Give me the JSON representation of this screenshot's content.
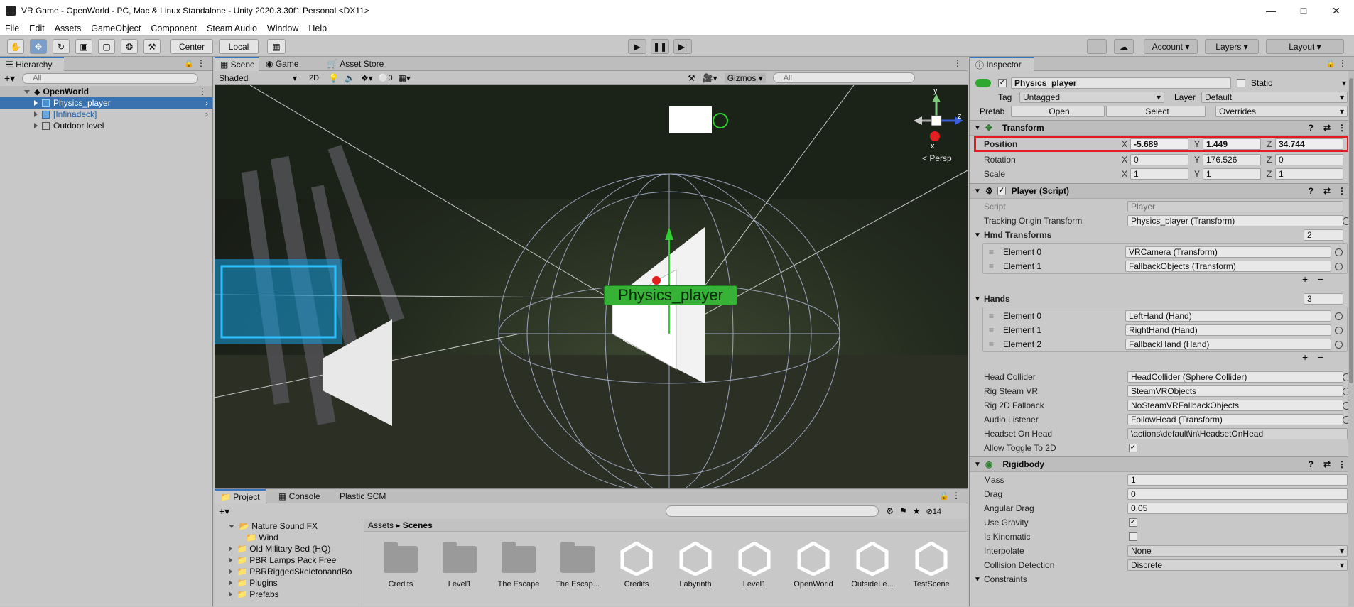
{
  "window": {
    "title": "VR Game - OpenWorld - PC, Mac & Linux Standalone - Unity 2020.3.30f1 Personal <DX11>"
  },
  "menu": [
    "File",
    "Edit",
    "Assets",
    "GameObject",
    "Component",
    "Steam Audio",
    "Window",
    "Help"
  ],
  "toolbar": {
    "center_label": "Center",
    "local_label": "Local",
    "account_label": "Account",
    "layers_label": "Layers",
    "layout_label": "Layout"
  },
  "hierarchy": {
    "tab": "Hierarchy",
    "search_placeholder": "All",
    "scene": "OpenWorld",
    "items": [
      {
        "label": "Physics_player"
      },
      {
        "label": "[Infinadeck]"
      },
      {
        "label": "Outdoor level"
      }
    ]
  },
  "scene_view": {
    "tabs": [
      "Scene",
      "Game",
      "Asset Store"
    ],
    "shading": "Shaded",
    "mode_2d": "2D",
    "hidden_count": "0",
    "gizmos": "Gizmos",
    "search_placeholder": "All",
    "persp_label": "< Persp",
    "object_label": "Physics_player",
    "axis_x": "x",
    "axis_y": "y",
    "axis_z": "z"
  },
  "project": {
    "tabs": [
      "Project",
      "Console",
      "Plastic SCM"
    ],
    "badge": "14",
    "tree": [
      "Nature Sound FX",
      "Wind",
      "Old Military Bed (HQ)",
      "PBR Lamps Pack Free",
      "PBRRiggedSkeletonandBo",
      "Plugins",
      "Prefabs"
    ],
    "breadcrumb": [
      "Assets",
      "Scenes"
    ],
    "assets": [
      {
        "name": "Credits",
        "kind": "folder"
      },
      {
        "name": "Level1",
        "kind": "folder"
      },
      {
        "name": "The Escape",
        "kind": "folder"
      },
      {
        "name": "The Escap...",
        "kind": "folder"
      },
      {
        "name": "Credits",
        "kind": "scene"
      },
      {
        "name": "Labyrinth",
        "kind": "scene"
      },
      {
        "name": "Level1",
        "kind": "scene"
      },
      {
        "name": "OpenWorld",
        "kind": "scene"
      },
      {
        "name": "OutsideLe...",
        "kind": "scene"
      },
      {
        "name": "TestScene",
        "kind": "scene"
      }
    ]
  },
  "inspector": {
    "tab": "Inspector",
    "object_name": "Physics_player",
    "static_label": "Static",
    "tag_label": "Tag",
    "tag_value": "Untagged",
    "layer_label": "Layer",
    "layer_value": "Default",
    "prefab_label": "Prefab",
    "open_label": "Open",
    "select_label": "Select",
    "overrides_label": "Overrides",
    "transform": {
      "title": "Transform",
      "position": {
        "label": "Position",
        "x": "-5.689",
        "y": "1.449",
        "z": "34.744"
      },
      "rotation": {
        "label": "Rotation",
        "x": "0",
        "y": "176.526",
        "z": "0"
      },
      "scale": {
        "label": "Scale",
        "x": "1",
        "y": "1",
        "z": "1"
      }
    },
    "player": {
      "title": "Player (Script)",
      "script_label": "Script",
      "script_value": "Player",
      "tracking_label": "Tracking Origin Transform",
      "tracking_value": "Physics_player (Transform)",
      "hmd_label": "Hmd Transforms",
      "hmd_count": "2",
      "hmd_elements": [
        {
          "label": "Element 0",
          "value": "VRCamera (Transform)"
        },
        {
          "label": "Element 1",
          "value": "FallbackObjects (Transform)"
        }
      ],
      "hands_label": "Hands",
      "hands_count": "3",
      "hand_elements": [
        {
          "label": "Element 0",
          "value": "LeftHand (Hand)"
        },
        {
          "label": "Element 1",
          "value": "RightHand (Hand)"
        },
        {
          "label": "Element 2",
          "value": "FallbackHand (Hand)"
        }
      ],
      "fields": [
        {
          "label": "Head Collider",
          "value": "HeadCollider (Sphere Collider)"
        },
        {
          "label": "Rig Steam VR",
          "value": "SteamVRObjects"
        },
        {
          "label": "Rig 2D Fallback",
          "value": "NoSteamVRFallbackObjects"
        },
        {
          "label": "Audio Listener",
          "value": "FollowHead (Transform)"
        },
        {
          "label": "Headset On Head",
          "value": "\\actions\\default\\in\\HeadsetOnHead"
        }
      ],
      "toggle_label": "Allow Toggle To 2D"
    },
    "rigidbody": {
      "title": "Rigidbody",
      "mass_label": "Mass",
      "mass": "1",
      "drag_label": "Drag",
      "drag": "0",
      "angular_label": "Angular Drag",
      "angular": "0.05",
      "gravity_label": "Use Gravity",
      "kinematic_label": "Is Kinematic",
      "interpolate_label": "Interpolate",
      "interpolate": "None",
      "collision_label": "Collision Detection",
      "collision": "Discrete",
      "constraints_label": "Constraints"
    }
  },
  "colors": {
    "highlight": "#e01b24",
    "selection": "#3a72b0",
    "label_green": "#2ea82e"
  }
}
